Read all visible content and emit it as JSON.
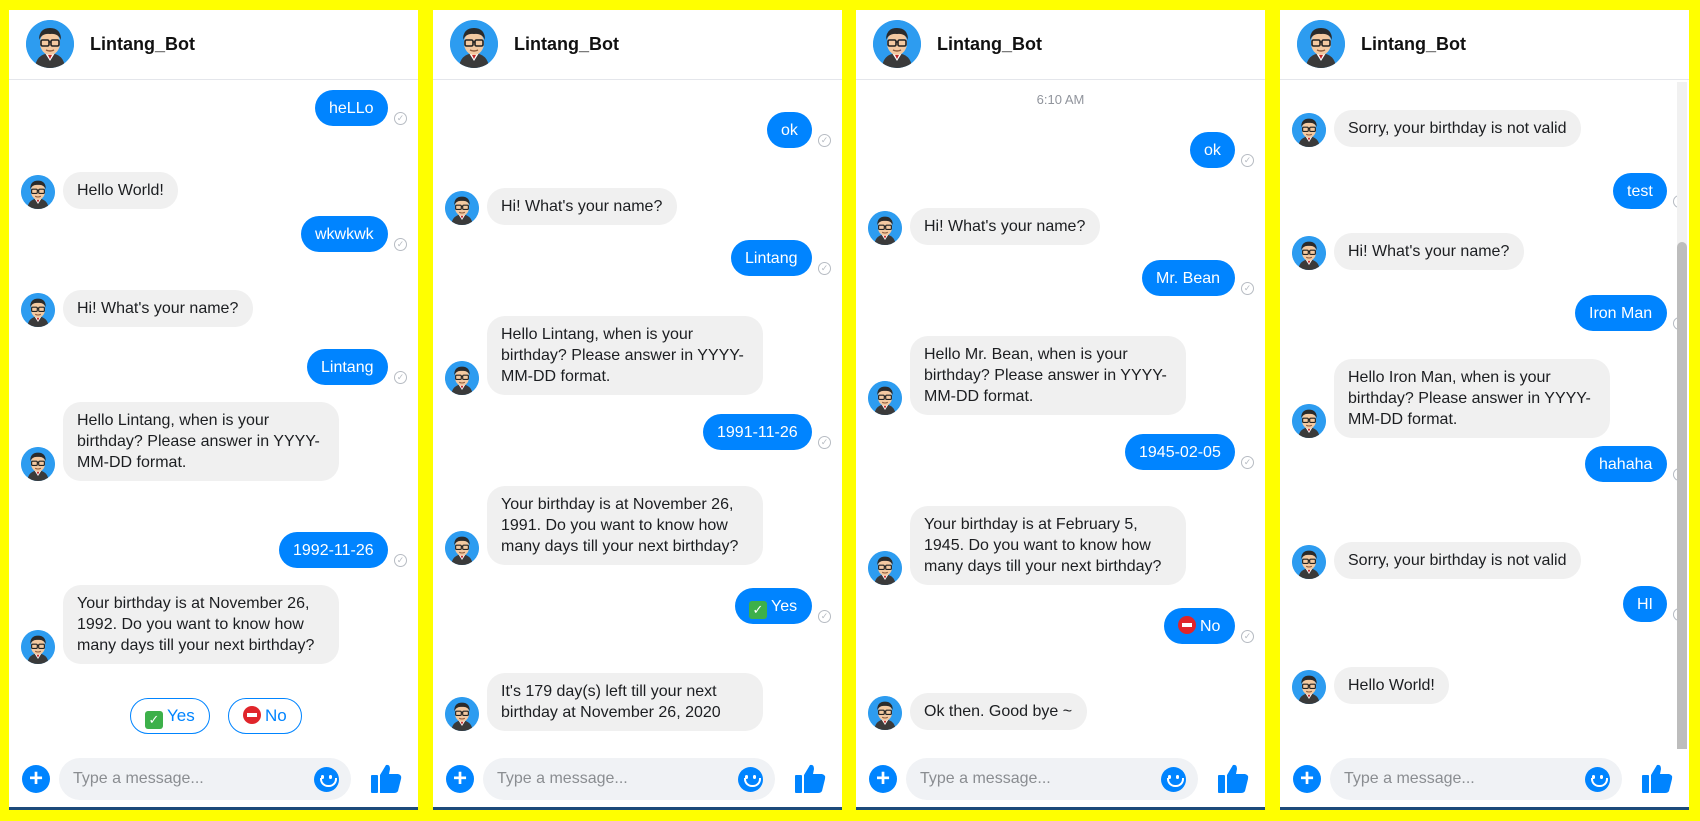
{
  "bot_name": "Lintang_Bot",
  "composer": {
    "placeholder": "Type a message..."
  },
  "colors": {
    "accent": "#0084ff",
    "bot_bubble": "#f0f0f0",
    "frame": "#ffff00"
  },
  "icons": [
    "avatar-icon",
    "read-check-icon",
    "plus-icon",
    "smiley-icon",
    "thumbs-up-icon"
  ],
  "panels": [
    {
      "messages": [
        {
          "from": "user",
          "text": "heLLo"
        },
        {
          "from": "bot",
          "text": "Hello World!"
        },
        {
          "from": "user",
          "text": "wkwkwk"
        },
        {
          "from": "bot",
          "text": "Hi! What's your name?"
        },
        {
          "from": "user",
          "text": "Lintang"
        },
        {
          "from": "bot",
          "text": "Hello Lintang, when is your birthday? Please answer in YYYY-MM-DD format."
        },
        {
          "from": "user",
          "text": "1992-11-26"
        },
        {
          "from": "bot",
          "text": "Your birthday is at November 26, 1992. Do you want to know how many days till your next birthday?"
        }
      ],
      "quick_replies": [
        "Yes",
        "No"
      ]
    },
    {
      "messages": [
        {
          "from": "user",
          "text": "ok"
        },
        {
          "from": "bot",
          "text": "Hi! What's your name?"
        },
        {
          "from": "user",
          "text": "Lintang"
        },
        {
          "from": "bot",
          "text": "Hello Lintang, when is your birthday? Please answer in YYYY-MM-DD format."
        },
        {
          "from": "user",
          "text": "1991-11-26"
        },
        {
          "from": "bot",
          "text": "Your birthday is at November 26, 1991. Do you want to know how many days till your next birthday?"
        },
        {
          "from": "user",
          "text": "Yes",
          "emoji": "yes"
        },
        {
          "from": "bot",
          "text": "It's 179 day(s) left till your next birthday at November 26, 2020"
        }
      ]
    },
    {
      "timestamp": "6:10 AM",
      "messages": [
        {
          "from": "user",
          "text": "ok"
        },
        {
          "from": "bot",
          "text": "Hi! What's your name?"
        },
        {
          "from": "user",
          "text": "Mr. Bean"
        },
        {
          "from": "bot",
          "text": "Hello Mr. Bean, when is your birthday? Please answer in YYYY-MM-DD format."
        },
        {
          "from": "user",
          "text": "1945-02-05"
        },
        {
          "from": "bot",
          "text": "Your birthday is at February 5, 1945. Do you want to know how many days till your next birthday?"
        },
        {
          "from": "user",
          "text": "No",
          "emoji": "no"
        },
        {
          "from": "bot",
          "text": "Ok then. Good bye ~"
        }
      ]
    },
    {
      "messages": [
        {
          "from": "bot",
          "text": "Sorry, your birthday is not valid"
        },
        {
          "from": "user",
          "text": "test"
        },
        {
          "from": "bot",
          "text": "Hi! What's your name?"
        },
        {
          "from": "user",
          "text": "Iron Man"
        },
        {
          "from": "bot",
          "text": "Hello Iron Man, when is your birthday? Please answer in YYYY-MM-DD format."
        },
        {
          "from": "user",
          "text": "hahaha"
        },
        {
          "from": "bot",
          "text": "Sorry, your birthday is not valid"
        },
        {
          "from": "user",
          "text": "HI"
        },
        {
          "from": "bot",
          "text": "Hello World!"
        }
      ]
    }
  ]
}
